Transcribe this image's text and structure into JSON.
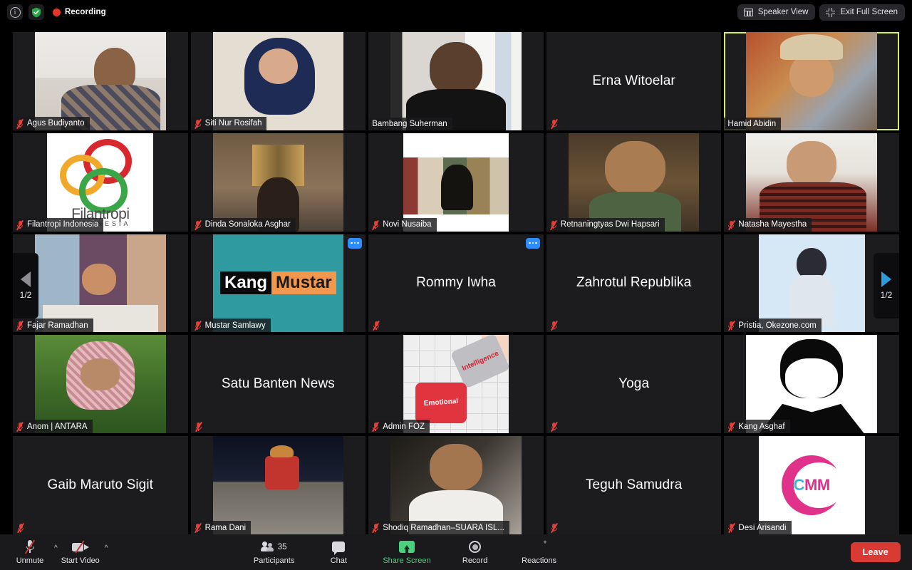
{
  "topbar": {
    "info_icon": "info-icon",
    "shield_icon": "shield-check-icon",
    "recording_label": "Recording",
    "speaker_view_label": "Speaker View",
    "exit_full_screen_label": "Exit Full Screen"
  },
  "pager": {
    "left_label": "1/2",
    "right_label": "1/2"
  },
  "tiles": [
    {
      "name": "Agus Budiyanto",
      "muted": true,
      "video": true,
      "active": false,
      "art": "ph-agus",
      "more": false
    },
    {
      "name": "Siti Nur Rosifah",
      "muted": true,
      "video": true,
      "active": false,
      "art": "ph-siti",
      "more": false
    },
    {
      "name": "Bambang Suherman",
      "muted": false,
      "video": true,
      "active": false,
      "art": "ph-bambang",
      "more": false
    },
    {
      "name": "Erna Witoelar",
      "muted": true,
      "video": false,
      "active": false,
      "art": "",
      "more": false
    },
    {
      "name": "Hamid Abidin",
      "muted": false,
      "video": true,
      "active": true,
      "art": "ph-hamid",
      "more": false
    },
    {
      "name": "Filantropi Indonesia",
      "muted": true,
      "video": true,
      "active": false,
      "art": "filantropi",
      "more": false
    },
    {
      "name": "Dinda Sonaloka Asghar",
      "muted": true,
      "video": true,
      "active": false,
      "art": "ph-dinda",
      "more": false
    },
    {
      "name": "Novi Nusaiba",
      "muted": true,
      "video": true,
      "active": false,
      "art": "ph-novi",
      "more": false
    },
    {
      "name": "Retnaningtyas Dwi Hapsari",
      "muted": true,
      "video": true,
      "active": false,
      "art": "ph-retna",
      "more": false
    },
    {
      "name": "Natasha Mayestha",
      "muted": true,
      "video": true,
      "active": false,
      "art": "ph-nata",
      "more": false
    },
    {
      "name": "Fajar Ramadhan",
      "muted": true,
      "video": true,
      "active": false,
      "art": "ph-fajar",
      "more": false
    },
    {
      "name": "Mustar Samlawy",
      "muted": true,
      "video": true,
      "active": false,
      "art": "kangmustar",
      "more": true
    },
    {
      "name": "Rommy Iwha",
      "muted": true,
      "video": false,
      "active": false,
      "art": "",
      "more": true
    },
    {
      "name": "Zahrotul Republika",
      "muted": true,
      "video": false,
      "active": false,
      "art": "",
      "more": false
    },
    {
      "name": "Pristia, Okezone.com",
      "muted": true,
      "video": true,
      "active": false,
      "art": "ph-pristia",
      "more": false
    },
    {
      "name": "Anom | ANTARA",
      "muted": true,
      "video": true,
      "active": false,
      "art": "ph-anom",
      "more": false
    },
    {
      "name": "Satu Banten News",
      "muted": true,
      "video": false,
      "active": false,
      "art": "",
      "more": false
    },
    {
      "name": "Admin FOZ",
      "muted": true,
      "video": true,
      "active": false,
      "art": "puzzle",
      "more": false
    },
    {
      "name": "Yoga",
      "muted": true,
      "video": false,
      "active": false,
      "art": "",
      "more": false
    },
    {
      "name": "Kang Asghaf",
      "muted": true,
      "video": true,
      "active": false,
      "art": "ph-asghaf",
      "more": false
    },
    {
      "name": "Gaib Maruto Sigit",
      "muted": true,
      "video": false,
      "active": false,
      "art": "",
      "more": false
    },
    {
      "name": "Rama Dani",
      "muted": true,
      "video": true,
      "active": false,
      "art": "ph-rama",
      "more": false
    },
    {
      "name": "Shodiq Ramadhan–SUARA ISL...",
      "muted": true,
      "video": true,
      "active": false,
      "art": "ph-shodiq",
      "more": false
    },
    {
      "name": "Teguh Samudra",
      "muted": true,
      "video": false,
      "active": false,
      "art": "",
      "more": false
    },
    {
      "name": "Desi Arisandi",
      "muted": true,
      "video": true,
      "active": false,
      "art": "cmm",
      "more": false
    }
  ],
  "tile_art": {
    "filantropi_text": "Filantropi",
    "filantropi_sub": "INDONESIA",
    "kangmustar_a": "Kang",
    "kangmustar_b": "Mustar",
    "puzzle_red": "Emotional",
    "puzzle_gray": "Intelligence",
    "cmm_c": "C",
    "cmm_mm": "MM"
  },
  "bottombar": {
    "unmute_label": "Unmute",
    "start_video_label": "Start Video",
    "participants_label": "Participants",
    "participants_count": "35",
    "chat_label": "Chat",
    "share_screen_label": "Share Screen",
    "record_label": "Record",
    "reactions_label": "Reactions",
    "leave_label": "Leave",
    "caret_glyph": "^"
  },
  "colors": {
    "accent_green": "#4ad17c",
    "leave_red": "#d93b34",
    "active_speaker": "#d8e96b",
    "more_blue": "#2d8cff",
    "recording_red": "#e8352c"
  }
}
